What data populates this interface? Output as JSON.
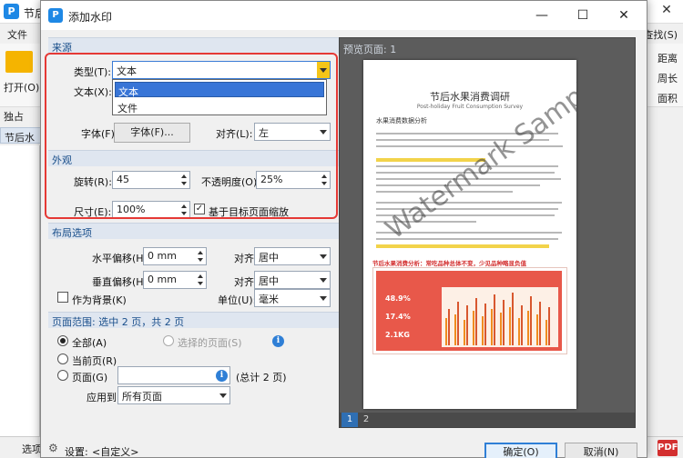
{
  "background_app": {
    "title": "节后",
    "menu_file": "文件",
    "open_label": "打开(O)...",
    "stamp_label": "独占",
    "tab_label": "节后水果",
    "right_items": [
      "查找(S)",
      "距离",
      "周长",
      "面积"
    ],
    "status_left": "选项"
  },
  "dialog": {
    "title": "添加水印",
    "minimize": "—",
    "maximize": "☐",
    "close": "✕"
  },
  "source": {
    "section": "来源",
    "type_label": "类型(T):",
    "type_value": "文本",
    "text_label": "文本(X):",
    "options": [
      "文本",
      "文件"
    ],
    "font_label": "字体(F):",
    "font_button": "字体(F)...",
    "align_label": "对齐(L):",
    "align_value": "左"
  },
  "appearance": {
    "section": "外观",
    "rotate_label": "旋转(R):",
    "rotate_value": "45",
    "opacity_label": "不透明度(O):",
    "opacity_value": "25%",
    "size_label": "尺寸(E):",
    "size_value": "100%",
    "scale_label": "基于目标页面缩放",
    "scale_checked": true
  },
  "layout": {
    "section": "布局选项",
    "h_offset_label": "水平偏移(H):",
    "h_offset_value": "0 mm",
    "h_align_label": "对齐:",
    "h_align_value": "居中",
    "v_offset_label": "垂直偏移(H):",
    "v_offset_value": "0 mm",
    "v_align_label": "对齐:",
    "v_align_value": "居中",
    "as_background_label": "作为背景(K)",
    "unit_label": "单位(U):",
    "unit_value": "毫米"
  },
  "page_range": {
    "section": "页面范围: 选中 2 页，共 2 页",
    "all_label": "全部(A)",
    "selected_label": "选择的页面(S)",
    "current_label": "当前页(R)",
    "pages_label": "页面(G)",
    "pages_total": "(总计 2 页)",
    "apply_label": "应用到:",
    "apply_value": "所有页面"
  },
  "preview": {
    "label": "预览页面: 1",
    "title": "节后水果消费调研",
    "subtitle": "Post-holiday Fruit Consumption Survey",
    "heading": "水果消费数据分析",
    "chart_title": "节后水果消费分析：常吃品种总体不变，少见品种略显负值",
    "stat1": "48.9%",
    "stat2": "17.4%",
    "stat3": "2.1KG",
    "watermark": "Watermark Sample",
    "page_tabs": [
      "1",
      "2"
    ]
  },
  "footer": {
    "settings_label": "设置:",
    "settings_value": "<自定义>",
    "ok": "确定(O)",
    "cancel": "取消(N)"
  },
  "colors": {
    "highlight": "#e53935",
    "accent": "#2f7fd6",
    "selected": "#3875d7"
  }
}
